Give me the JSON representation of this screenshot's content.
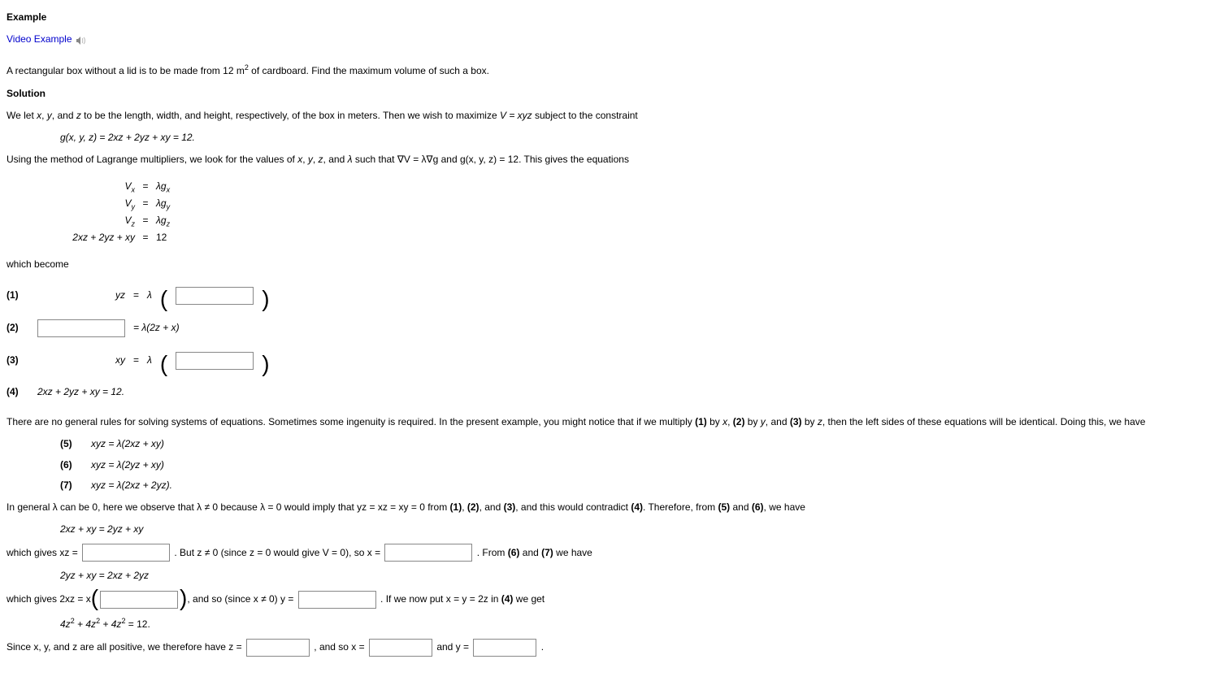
{
  "title": "Example",
  "videoLink": "Video Example",
  "problem_a": "A rectangular box without a lid is to be made from 12 m",
  "problem_b": " of cardboard. Find the maximum volume of such a box.",
  "solutionHeading": "Solution",
  "intro_a": "We let ",
  "intro_b": " to be the length, width, and height, respectively, of the box in meters. Then we wish to maximize ",
  "intro_c": " subject to the constraint",
  "constraint_lhs": "g(x, y, z)",
  "constraint_rhs": "2xz + 2yz + xy = 12.",
  "lagrange_a": "Using the method of Lagrange multipliers, we look for the values of ",
  "lagrange_b": " such that ∇V = λ∇g and g(x, y, z) = 12. This gives the equations",
  "sys": {
    "r1l": "V",
    "r1ls": "x",
    "r1r": "λg",
    "r1rs": "x",
    "r2l": "V",
    "r2ls": "y",
    "r2r": "λg",
    "r2rs": "y",
    "r3l": "V",
    "r3ls": "z",
    "r3r": "λg",
    "r3rs": "z",
    "r4l": "2xz + 2yz + xy",
    "r4r": "12"
  },
  "whichBecome": "which become",
  "eq1": {
    "n": "(1)",
    "lhs": "yz",
    "eq": "=",
    "lam": "λ"
  },
  "eq2": {
    "n": "(2)",
    "rhs": "= λ(2z + x)"
  },
  "eq3": {
    "n": "(3)",
    "lhs": "xy",
    "eq": "=",
    "lam": "λ"
  },
  "eq4": {
    "n": "(4)",
    "txt": "2xz + 2yz + xy = 12."
  },
  "para_mult": "There are no general rules for solving systems of equations. Sometimes some ingenuity is required. In the present example, you might notice that if we multiply (1) by x, (2) by y, and (3) by z, then the left sides of these equations will be identical. Doing this, we have",
  "s5": {
    "n": "(5)",
    "t": "xyz = λ(2xz + xy)"
  },
  "s6": {
    "n": "(6)",
    "t": "xyz = λ(2yz + xy)"
  },
  "s7": {
    "n": "(7)",
    "t": "xyz = λ(2xz + 2yz)."
  },
  "para_lambda_a": "In general λ can be 0, here we observe that λ ≠ 0 because λ = 0 would imply that yz = xz = xy = 0 from ",
  "para_lambda_b": ", and this would contradict ",
  "para_lambda_c": ". Therefore, from ",
  "para_lambda_d": ", we have",
  "simpl1": "2xz + xy = 2yz + xy",
  "flow1_a": "which gives xz = ",
  "flow1_b": " . But z ≠ 0 (since z = 0 would give V = 0), so x = ",
  "flow1_c": " . From ",
  "flow1_d": " we have",
  "simpl2": "2yz + xy = 2xz + 2yz",
  "flow2_a": "which gives 2xz = x",
  "flow2_b": ", and so (since x ≠ 0) y = ",
  "flow2_c": " . If we now put x = y = 2z in ",
  "flow2_d": " we get",
  "simpl3_a": "4z",
  "simpl3_b": " + 4z",
  "simpl3_c": " + 4z",
  "simpl3_d": " = 12.",
  "final_a": "Since x, y, and z are all positive, we therefore have z = ",
  "final_b": " , and so x = ",
  "final_c": " and y = ",
  "final_d": " .",
  "bold": {
    "b1": "(1)",
    "b2": "(2)",
    "b3": "(3)",
    "b4": "(4)",
    "b5": "(5)",
    "b6": "(6)",
    "b7": "(7)"
  },
  "conj_and": " and ",
  "conj_comma_and": ", and "
}
